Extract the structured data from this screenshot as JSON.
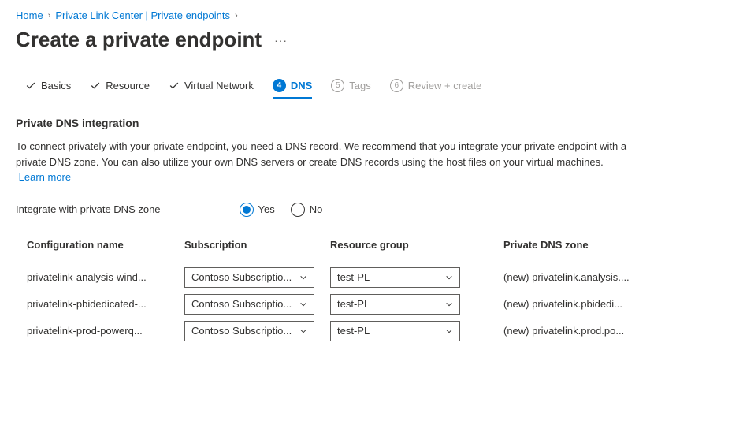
{
  "breadcrumb": {
    "home": "Home",
    "private_link": "Private Link Center | Private endpoints"
  },
  "page_title": "Create a private endpoint",
  "tabs": {
    "basics": "Basics",
    "resource": "Resource",
    "virtual_network": "Virtual Network",
    "dns": {
      "num": "4",
      "label": "DNS"
    },
    "tags": {
      "num": "5",
      "label": "Tags"
    },
    "review": {
      "num": "6",
      "label": "Review + create"
    }
  },
  "section": {
    "title": "Private DNS integration",
    "description": "To connect privately with your private endpoint, you need a DNS record. We recommend that you integrate your private endpoint with a private DNS zone. You can also utilize your own DNS servers or create DNS records using the host files on your virtual machines.",
    "learn_more": "Learn more"
  },
  "integrate": {
    "label": "Integrate with private DNS zone",
    "yes": "Yes",
    "no": "No"
  },
  "table": {
    "headers": {
      "config_name": "Configuration name",
      "subscription": "Subscription",
      "resource_group": "Resource group",
      "private_dns_zone": "Private DNS zone"
    },
    "rows": [
      {
        "config_name": "privatelink-analysis-wind...",
        "subscription": "Contoso Subscriptio...",
        "resource_group": "test-PL",
        "zone": "(new) privatelink.analysis...."
      },
      {
        "config_name": "privatelink-pbidedicated-...",
        "subscription": "Contoso Subscriptio...",
        "resource_group": "test-PL",
        "zone": "(new) privatelink.pbidedi..."
      },
      {
        "config_name": "privatelink-prod-powerq...",
        "subscription": "Contoso Subscriptio...",
        "resource_group": "test-PL",
        "zone": "(new) privatelink.prod.po..."
      }
    ]
  }
}
